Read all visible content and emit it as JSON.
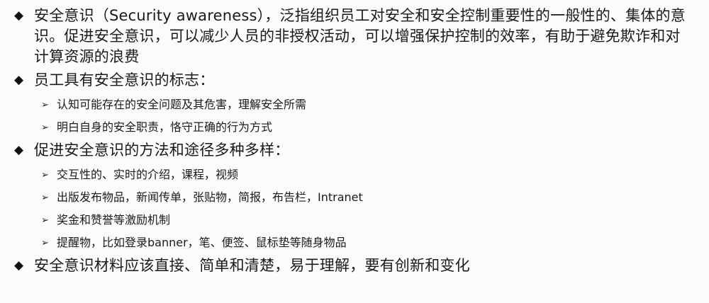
{
  "bullets": [
    {
      "text": "安全意识（Security awareness），泛指组织员工对安全和安全控制重要性的一般性的、集体的意识。促进安全意识，可以减少人员的非授权活动，可以增强保护控制的效率，有助于避免欺诈和对计算资源的浪费",
      "subs": []
    },
    {
      "text": "员工具有安全意识的标志：",
      "subs": [
        "认知可能存在的安全问题及其危害，理解安全所需",
        "明白自身的安全职责，恪守正确的行为方式"
      ]
    },
    {
      "text": "促进安全意识的方法和途径多种多样：",
      "subs": [
        "交互性的、实时的介绍，课程，视频",
        "出版发布物品，新闻传单，张贴物，简报，布告栏，Intranet",
        "奖金和赞誉等激励机制",
        "提醒物，比如登录banner，笔、便签、鼠标垫等随身物品"
      ]
    },
    {
      "text": "安全意识材料应该直接、简单和清楚，易于理解，要有创新和变化",
      "subs": []
    }
  ],
  "icons": {
    "bullet_l1": "◆",
    "bullet_l2": "➢"
  }
}
